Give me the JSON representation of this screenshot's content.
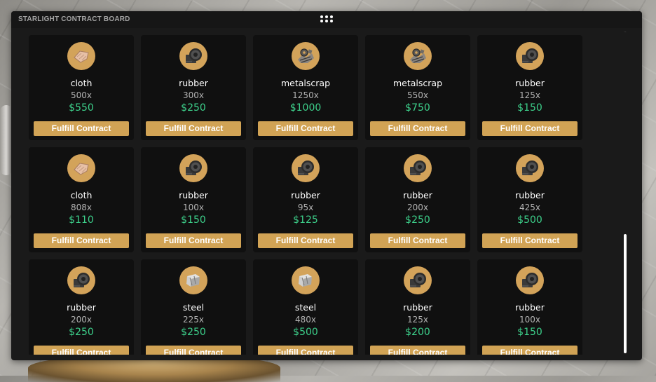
{
  "window": {
    "title": "STARLIGHT CONTRACT BOARD",
    "handle_icon": "drag-handle-icon",
    "mini_dots": ".."
  },
  "colors": {
    "panel": "#1a1a1a",
    "card": "#101010",
    "accent_gold": "#d1a355",
    "price_green": "#3dd18b",
    "qty_gray": "#b3b3b3"
  },
  "contracts": [
    {
      "item": "cloth",
      "icon": "cloth-icon",
      "quantity": "500x",
      "reward": "$550",
      "button": "Fulfill Contract"
    },
    {
      "item": "rubber",
      "icon": "rubber-icon",
      "quantity": "300x",
      "reward": "$250",
      "button": "Fulfill Contract"
    },
    {
      "item": "metalscrap",
      "icon": "metalscrap-icon",
      "quantity": "1250x",
      "reward": "$1000",
      "button": "Fulfill Contract"
    },
    {
      "item": "metalscrap",
      "icon": "metalscrap-icon",
      "quantity": "550x",
      "reward": "$750",
      "button": "Fulfill Contract"
    },
    {
      "item": "rubber",
      "icon": "rubber-icon",
      "quantity": "125x",
      "reward": "$150",
      "button": "Fulfill Contract"
    },
    {
      "item": "cloth",
      "icon": "cloth-icon",
      "quantity": "808x",
      "reward": "$110",
      "button": "Fulfill Contract"
    },
    {
      "item": "rubber",
      "icon": "rubber-icon",
      "quantity": "100x",
      "reward": "$150",
      "button": "Fulfill Contract"
    },
    {
      "item": "rubber",
      "icon": "rubber-icon",
      "quantity": "95x",
      "reward": "$125",
      "button": "Fulfill Contract"
    },
    {
      "item": "rubber",
      "icon": "rubber-icon",
      "quantity": "200x",
      "reward": "$250",
      "button": "Fulfill Contract"
    },
    {
      "item": "rubber",
      "icon": "rubber-icon",
      "quantity": "425x",
      "reward": "$500",
      "button": "Fulfill Contract"
    },
    {
      "item": "rubber",
      "icon": "rubber-icon",
      "quantity": "200x",
      "reward": "$250",
      "button": "Fulfill Contract"
    },
    {
      "item": "steel",
      "icon": "steel-icon",
      "quantity": "225x",
      "reward": "$250",
      "button": "Fulfill Contract"
    },
    {
      "item": "steel",
      "icon": "steel-icon",
      "quantity": "480x",
      "reward": "$500",
      "button": "Fulfill Contract"
    },
    {
      "item": "rubber",
      "icon": "rubber-icon",
      "quantity": "125x",
      "reward": "$200",
      "button": "Fulfill Contract"
    },
    {
      "item": "rubber",
      "icon": "rubber-icon",
      "quantity": "100x",
      "reward": "$150",
      "button": "Fulfill Contract"
    }
  ]
}
